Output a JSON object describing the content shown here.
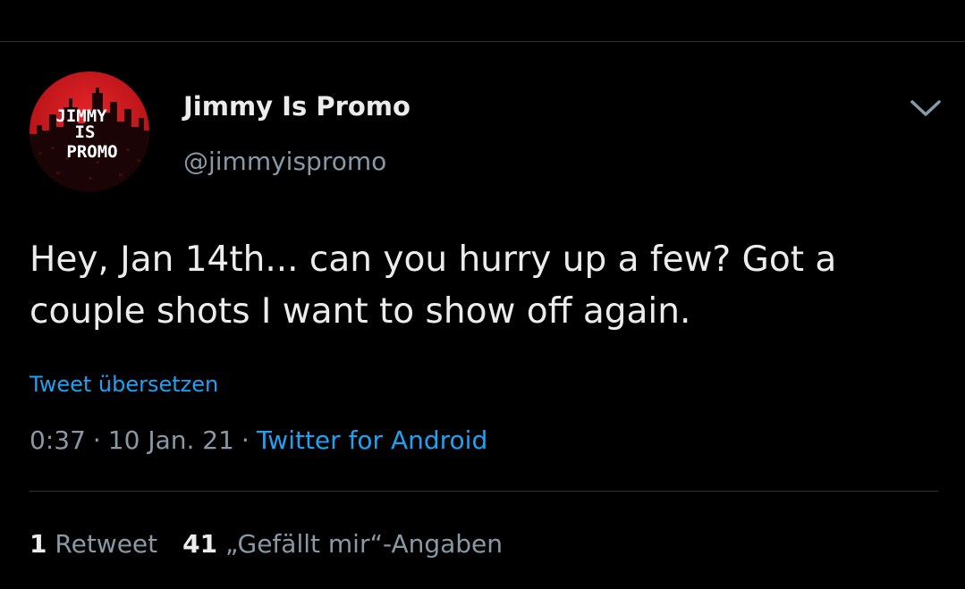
{
  "tweet": {
    "author": {
      "name": "Jimmy Is Promo",
      "handle": "@jimmyispromo",
      "avatar_text": [
        "JIMMY",
        "IS",
        "PROMO"
      ]
    },
    "text": "Hey, Jan 14th... can you hurry up a few? Got a couple shots I want to show off again.",
    "translate_label": "Tweet übersetzen",
    "time": "0:37",
    "date": "10 Jan. 21",
    "separator": "·",
    "source": "Twitter for Android",
    "stats": {
      "retweets_count": "1",
      "retweets_label": "Retweet",
      "likes_count": "41",
      "likes_label": "„Gefällt mir“-Angaben"
    }
  },
  "icons": {
    "menu": "chevron-down-icon"
  },
  "colors": {
    "background": "#000000",
    "text": "#ececec",
    "muted": "#8899a6",
    "accent": "#1da1f2",
    "avatar_red": "#c8151b"
  }
}
